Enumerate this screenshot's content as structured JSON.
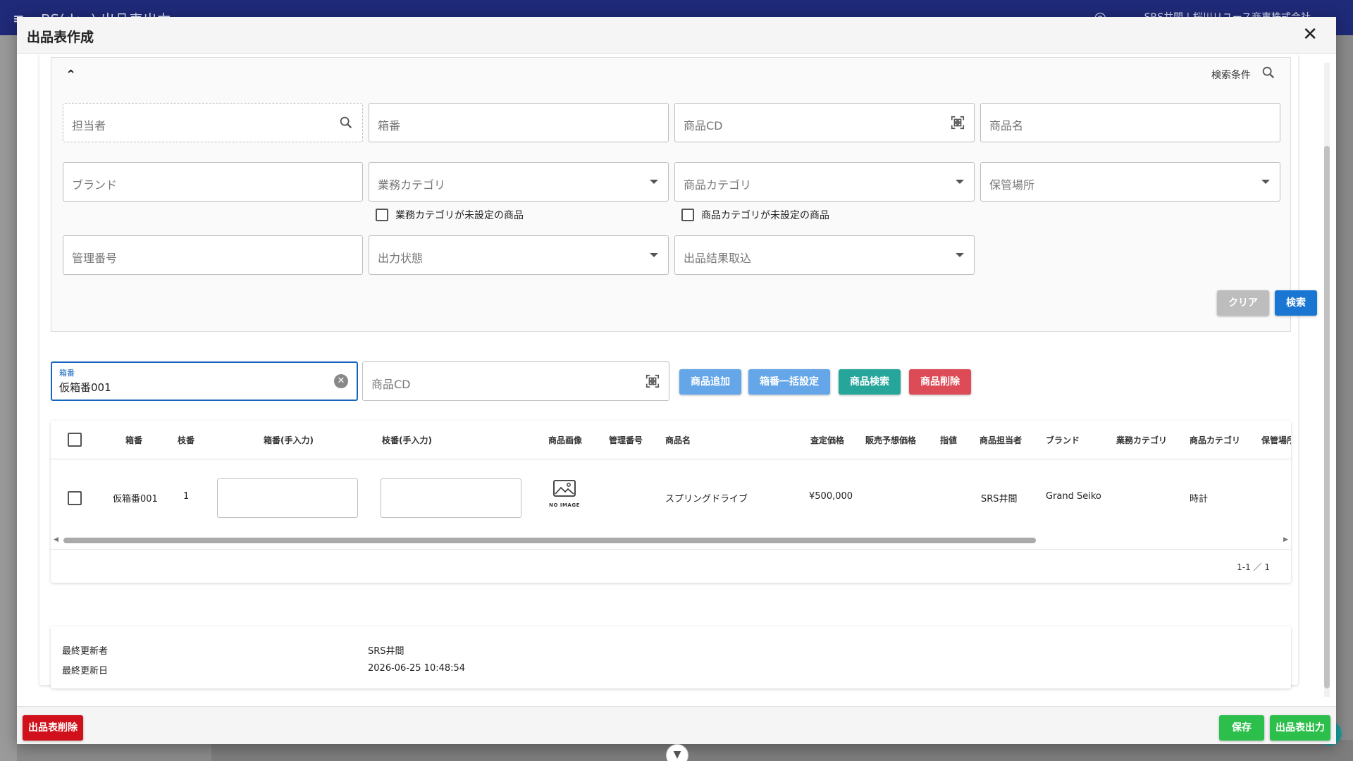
{
  "background": {
    "app_title": "BS(dev) 出品表出力",
    "user": "SRS井間 | 桜川リユース商事株式会社"
  },
  "modal": {
    "title": "出品表作成",
    "close_icon": "close-icon"
  },
  "search": {
    "conditions_label": "検索条件",
    "fields": {
      "staff": "担当者",
      "box_no": "箱番",
      "product_cd": "商品CD",
      "product_name": "商品名",
      "brand": "ブランド",
      "business_category": "業務カテゴリ",
      "product_category": "商品カテゴリ",
      "storage": "保管場所",
      "management_no": "管理番号",
      "output_status": "出力状態",
      "result_import": "出品結果取込"
    },
    "checkboxes": {
      "no_business_category": "業務カテゴリが未設定の商品",
      "no_product_category": "商品カテゴリが未設定の商品"
    },
    "buttons": {
      "clear": "クリア",
      "search": "検索"
    }
  },
  "entry": {
    "box_label": "箱番",
    "box_value": "仮箱番001",
    "product_cd_placeholder": "商品CD",
    "buttons": {
      "add_product": "商品追加",
      "bulk_box": "箱番一括設定",
      "search_product": "商品検索",
      "delete_product": "商品削除"
    }
  },
  "table": {
    "columns": [
      "箱番",
      "枝番",
      "箱番(手入力)",
      "枝番(手入力)",
      "商品画像",
      "管理番号",
      "商品名",
      "査定価格",
      "販売予想価格",
      "指値",
      "商品担当者",
      "ブランド",
      "業務カテゴリ",
      "商品カテゴリ",
      "保管場所"
    ],
    "rows": [
      {
        "box_no": "仮箱番001",
        "branch_no": "1",
        "image_label": "NO IMAGE",
        "product_name": "スプリングドライブ",
        "appraisal_price": "¥500,000",
        "staff": "SRS井間",
        "brand": "Grand Seiko",
        "product_category": "時計"
      }
    ],
    "pagination": "1-1 ／ 1"
  },
  "info": {
    "last_updated_by_label": "最終更新者",
    "last_updated_by": "SRS井間",
    "last_updated_at_label": "最終更新日",
    "last_updated_at": "2026-06-25 10:48:54"
  },
  "footer": {
    "delete_sheet": "出品表削除",
    "save": "保存",
    "output_sheet": "出品表出力"
  },
  "colors": {
    "primary": "#1976d2",
    "light_blue": "#64a6e8",
    "teal": "#26a69a",
    "red": "#dc4b56",
    "dark_red": "#d0101b",
    "green": "#2dbf4b",
    "grey": "#bdbdbd",
    "appbar": "#1f2a78"
  }
}
